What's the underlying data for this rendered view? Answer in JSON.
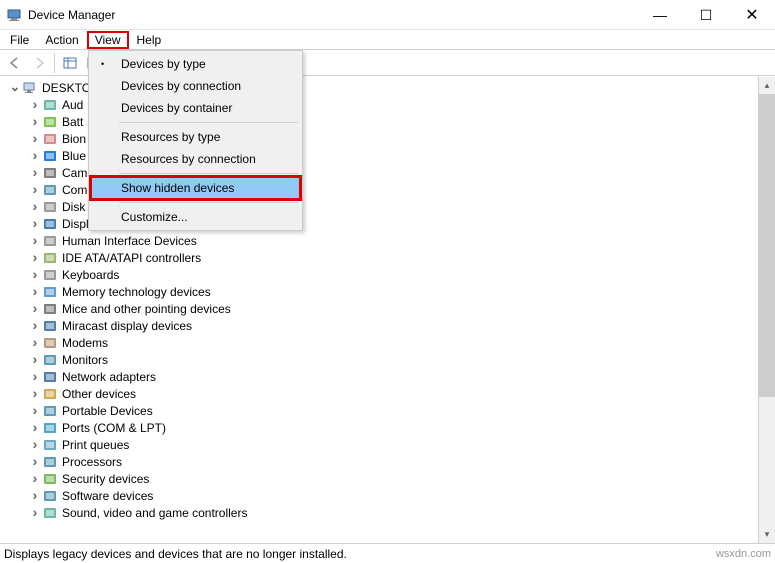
{
  "window": {
    "title": "Device Manager"
  },
  "menubar": [
    "File",
    "Action",
    "View",
    "Help"
  ],
  "dropdown": {
    "items": [
      {
        "label": "Devices by type",
        "checked": true
      },
      {
        "label": "Devices by connection"
      },
      {
        "label": "Devices by container"
      },
      {
        "sep": true
      },
      {
        "label": "Resources by type"
      },
      {
        "label": "Resources by connection"
      },
      {
        "sep": true
      },
      {
        "label": "Show hidden devices",
        "selected": true,
        "boxed": true
      },
      {
        "sep": true
      },
      {
        "label": "Customize..."
      }
    ]
  },
  "tree": {
    "root": "DESKTO",
    "nodes": [
      {
        "label": "Aud",
        "icon": "speaker"
      },
      {
        "label": "Batt",
        "icon": "battery"
      },
      {
        "label": "Bion",
        "icon": "fingerprint"
      },
      {
        "label": "Blue",
        "icon": "bluetooth"
      },
      {
        "label": "Cam",
        "icon": "camera"
      },
      {
        "label": "Com",
        "icon": "monitor"
      },
      {
        "label": "Disk",
        "icon": "disk"
      },
      {
        "label": "Display adapters",
        "icon": "display-adapter"
      },
      {
        "label": "Human Interface Devices",
        "icon": "hid"
      },
      {
        "label": "IDE ATA/ATAPI controllers",
        "icon": "ide"
      },
      {
        "label": "Keyboards",
        "icon": "keyboard"
      },
      {
        "label": "Memory technology devices",
        "icon": "memory"
      },
      {
        "label": "Mice and other pointing devices",
        "icon": "mouse"
      },
      {
        "label": "Miracast display devices",
        "icon": "miracast"
      },
      {
        "label": "Modems",
        "icon": "modem"
      },
      {
        "label": "Monitors",
        "icon": "monitor"
      },
      {
        "label": "Network adapters",
        "icon": "network"
      },
      {
        "label": "Other devices",
        "icon": "other"
      },
      {
        "label": "Portable Devices",
        "icon": "portable"
      },
      {
        "label": "Ports (COM & LPT)",
        "icon": "ports"
      },
      {
        "label": "Print queues",
        "icon": "printer"
      },
      {
        "label": "Processors",
        "icon": "processor"
      },
      {
        "label": "Security devices",
        "icon": "security"
      },
      {
        "label": "Software devices",
        "icon": "software"
      },
      {
        "label": "Sound, video and game controllers",
        "icon": "sound"
      }
    ]
  },
  "statusbar": {
    "text": "Displays legacy devices and devices that are no longer installed.",
    "source": "wsxdn.com"
  }
}
